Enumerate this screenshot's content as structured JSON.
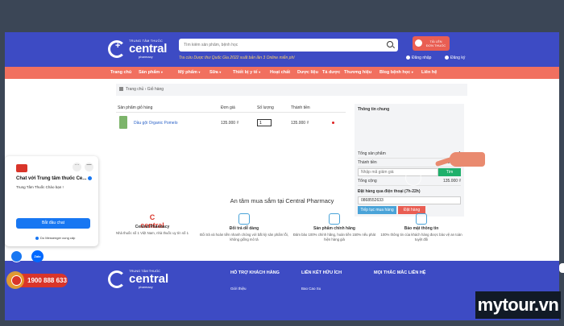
{
  "header": {
    "logo_tag": "TRUNG TÂM THUỐC",
    "logo_name": "central",
    "logo_sub": "pharmacy",
    "search_placeholder": "Tìm kiếm sản phẩm, bệnh học",
    "promo_text": "Tra cứu Dược thư Quốc Gia 2022 xuất bản lần 3 Online miễn phí",
    "rx_line1": "TẢI LÊN",
    "rx_line2": "ĐƠN THUỐC",
    "login": "Đăng nhập",
    "register": "Đăng ký"
  },
  "nav": {
    "items": [
      "Trang chủ",
      "Sản phẩm",
      "Mỹ phẩm",
      "Sữa",
      "Thiết bị y tế",
      "Hoạt chất",
      "Dược liệu",
      "Tá dược",
      "Thương hiệu",
      "Blog bệnh học",
      "Liên hệ"
    ],
    "chevron": "▾"
  },
  "breadcrumb": {
    "text": "Trang chủ › Giỏ hàng"
  },
  "cart": {
    "headers": [
      "Sản phẩm giỏ hàng",
      "Đơn giá",
      "Số lượng",
      "Thành tiền"
    ],
    "item": {
      "name": "Dầu gội Organic Pomelo",
      "price": "135.000 ₫",
      "quantity": "1",
      "total": "135.000 ₫"
    }
  },
  "summary": {
    "title": "Thông tin chung",
    "rows": [
      {
        "label": "Tổng sản phẩm",
        "value": "1"
      },
      {
        "label": "Thành tiền",
        "value": "135.000 ₫"
      }
    ],
    "voucher_placeholder": "Nhập mã giảm giá",
    "voucher_button": "Tìm",
    "total_label": "Tổng cộng",
    "total_value": "135.000 ₫",
    "phone_label": "Đặt hàng qua điện thoại (7h-22h)",
    "phone_value": "0868552633",
    "continue_button": "Tiếp tục mua hàng",
    "order_button": "Đặt hàng"
  },
  "trust": {
    "title": "An tâm mua sắm tại Central Pharmacy",
    "features": [
      {
        "title": "Central Pharmacy",
        "desc": "Nhà thuốc số 1 Việt Nam, nhà thuốc uy tín số 1",
        "icon": "central-logo-icon"
      },
      {
        "title": "Đổi trả dễ dàng",
        "desc": "Đổi trả và hoàn tiền nhanh chóng với bất kỳ sản phẩm lỗi, không giống mô tả",
        "icon": "return-icon"
      },
      {
        "title": "Sản phẩm chính hãng",
        "desc": "Đảm bảo 100% chính hãng, hoàn tiền 150% nếu phát hiện hàng giả",
        "icon": "shield-check-icon"
      },
      {
        "title": "Bảo mật thông tin",
        "desc": "100% thông tin của khách hàng được bảo vệ an toàn tuyệt đối",
        "icon": "shield-lock-icon"
      }
    ]
  },
  "footer": {
    "col1": "HỖ TRỢ KHÁCH HÀNG",
    "col1_link": "Giới thiệu",
    "col2": "LIÊN KẾT HỮU ÍCH",
    "col2_link": "Bao Cao Su",
    "col3": "MỌI THẮC MẮC LIÊN HỆ"
  },
  "chat": {
    "title": "Chat với Trung tâm thuốc Ce...",
    "message": "Trung Tâm Thuốc Chào bạn !",
    "start_button": "Bắt đầu chat",
    "powered_by": "Do Messenger cung cấp",
    "more": "···",
    "minimize": "—"
  },
  "floating": {
    "zalo": "Zalo",
    "hotline": "1900 888 633"
  },
  "watermark": "mytour.vn",
  "colors": {
    "header_blue": "#3d4bc4",
    "nav_coral": "#f1705f",
    "order_red": "#e95e53",
    "voucher_green": "#1fb06b",
    "continue_blue": "#4aa3d8"
  }
}
